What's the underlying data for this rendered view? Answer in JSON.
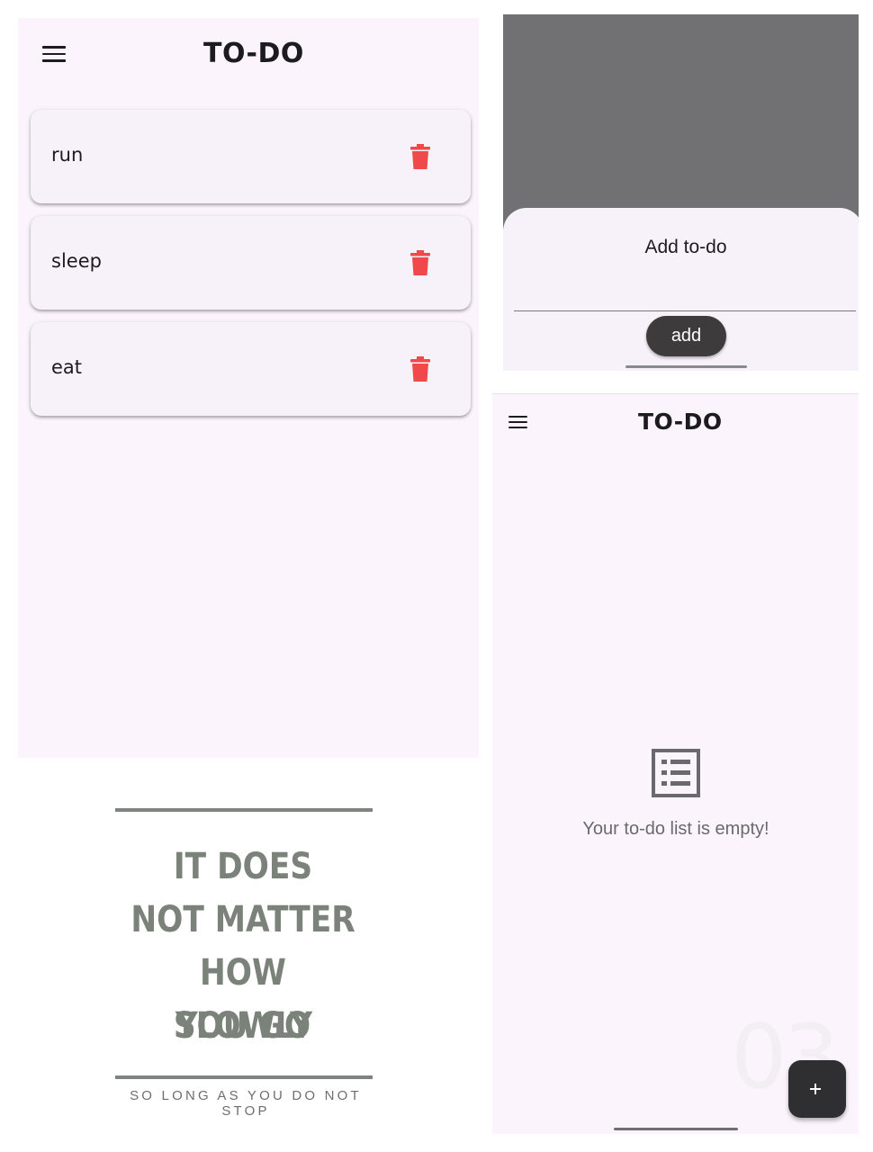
{
  "left_screen": {
    "title": "TO-DO",
    "todos": [
      {
        "text": "run"
      },
      {
        "text": "sleep"
      },
      {
        "text": "eat"
      }
    ],
    "delete_icon": "trash-icon",
    "menu_icon": "hamburger-menu-icon"
  },
  "poster": {
    "lines": [
      "IT DOES",
      "NOT MATTER",
      "HOW SLOWLY",
      "YOU GO"
    ],
    "subtitle": "SO LONG AS YOU DO NOT STOP"
  },
  "sheet_screen": {
    "sheet_title": "Add to-do",
    "input_value": "",
    "add_label": "add"
  },
  "empty_screen": {
    "title": "TO-DO",
    "empty_message": "Your to-do list is empty!",
    "empty_icon": "list-icon",
    "fab_icon": "plus-icon",
    "watermark": "03"
  },
  "colors": {
    "delete_red": "#f0494b",
    "background": "#fcf4fc",
    "card": "#f7f2fa",
    "scrim": "#717073",
    "button_dark": "#3d3b3c"
  }
}
